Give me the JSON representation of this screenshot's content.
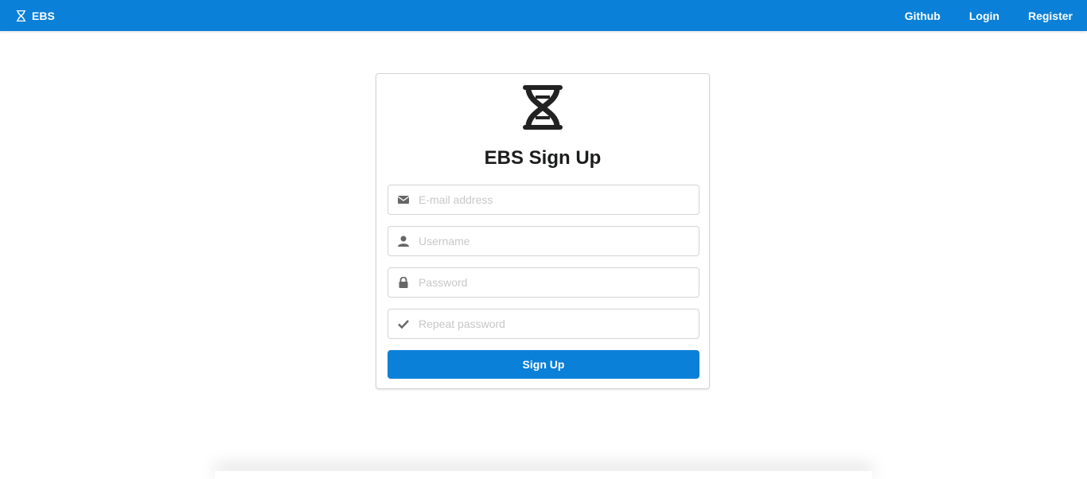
{
  "navbar": {
    "brand": "EBS",
    "links": [
      "Github",
      "Login",
      "Register"
    ],
    "color": "#0a80d8"
  },
  "form": {
    "title": "EBS Sign Up",
    "logo_icon": "dna-icon",
    "fields": [
      {
        "icon": "envelope-icon",
        "placeholder": "E-mail address",
        "value": ""
      },
      {
        "icon": "user-icon",
        "placeholder": "Username",
        "value": ""
      },
      {
        "icon": "lock-icon",
        "placeholder": "Password",
        "value": ""
      },
      {
        "icon": "check-icon",
        "placeholder": "Repeat password",
        "value": ""
      }
    ],
    "submit_label": "Sign Up"
  }
}
